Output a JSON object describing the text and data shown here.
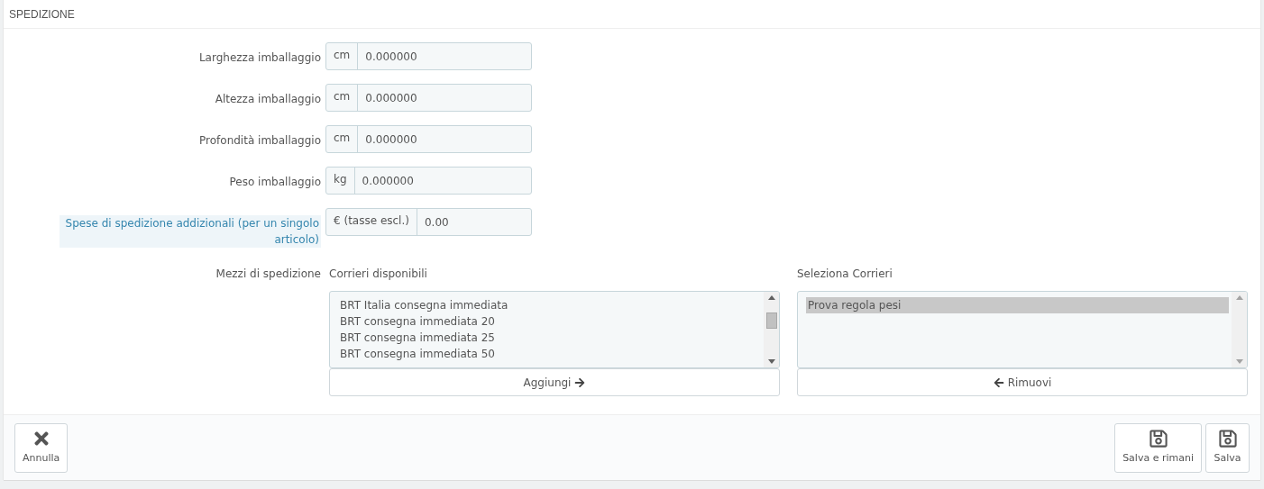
{
  "panel": {
    "title": "SPEDIZIONE"
  },
  "fields": [
    {
      "label": "Larghezza imballaggio",
      "unit": "cm",
      "value": "0.000000",
      "highlighted": false
    },
    {
      "label": "Altezza imballaggio",
      "unit": "cm",
      "value": "0.000000",
      "highlighted": false
    },
    {
      "label": "Profondità imballaggio",
      "unit": "cm",
      "value": "0.000000",
      "highlighted": false
    },
    {
      "label": "Peso imballaggio",
      "unit": "kg",
      "value": "0.000000",
      "highlighted": false
    },
    {
      "label": "Spese di spedizione addizionali (per un singolo articolo)",
      "unit": "€ (tasse escl.)",
      "value": "0.00",
      "highlighted": true
    }
  ],
  "carriers": {
    "label": "Mezzi di spedizione",
    "available": {
      "title": "Corrieri disponibili",
      "items": [
        {
          "text": "BRT Italia consegna immediata",
          "selected": false
        },
        {
          "text": "BRT consegna immediata 20",
          "selected": false
        },
        {
          "text": "BRT consegna immediata 25",
          "selected": false
        },
        {
          "text": "BRT consegna immediata 50",
          "selected": false
        }
      ],
      "button": "Aggiungi"
    },
    "chosen": {
      "title": "Seleziona Corrieri",
      "items": [
        {
          "text": "Prova regola pesi",
          "selected": true
        }
      ],
      "button": "Rimuovi"
    }
  },
  "footer": {
    "buttons": [
      {
        "label": "Annulla",
        "kind": "cancel"
      },
      {
        "label": "Salva e rimani",
        "kind": "save"
      },
      {
        "label": "Salva",
        "kind": "save"
      }
    ]
  }
}
